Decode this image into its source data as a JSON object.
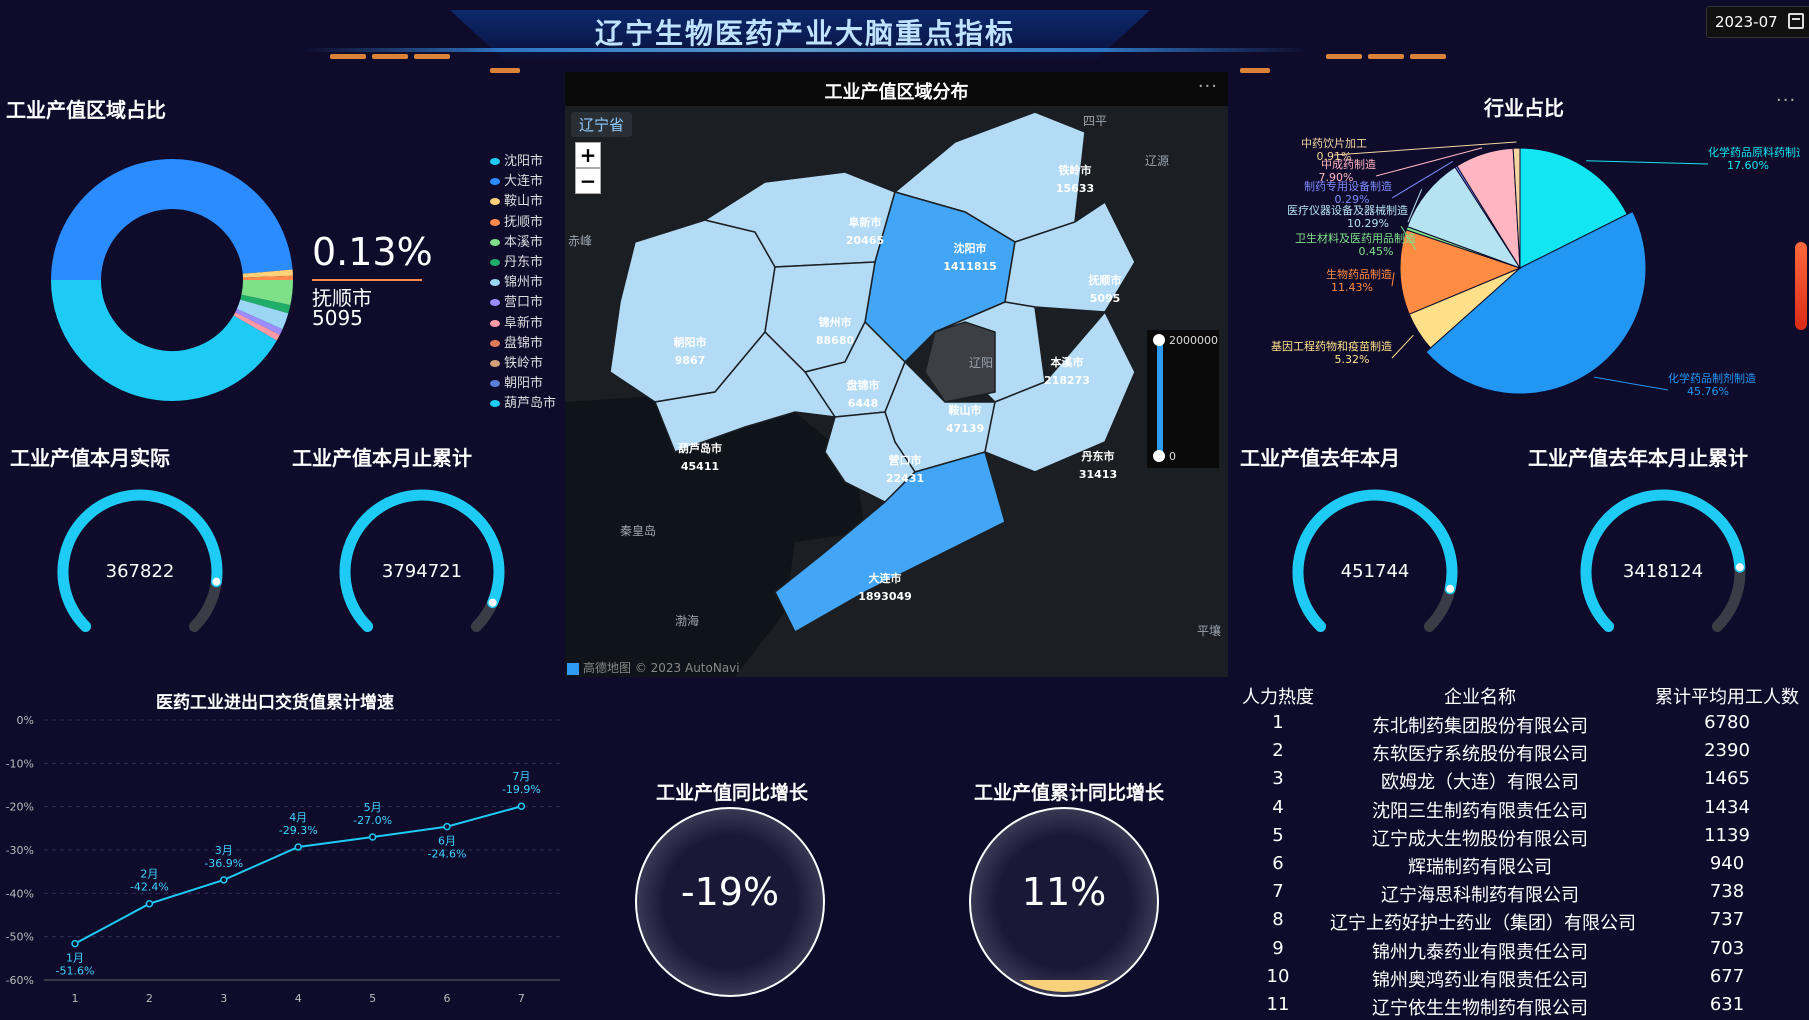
{
  "header": {
    "title": "辽宁生物医药产业大脑重点指标",
    "date": "2023-07"
  },
  "colors": {
    "background": "#0e0b2b",
    "accent_cyan": "#1ecbf5",
    "gauge_track": "#3a3d45",
    "map_dark": "#1b1f24"
  },
  "region_share": {
    "title": "工业产值区域占比",
    "highlight": {
      "percent": "0.13%",
      "city": "抚顺市",
      "value": "5095"
    },
    "legend": [
      {
        "name": "沈阳市",
        "color": "#1ecbf5"
      },
      {
        "name": "大连市",
        "color": "#2b8cff"
      },
      {
        "name": "鞍山市",
        "color": "#ffd27a"
      },
      {
        "name": "抚顺市",
        "color": "#ff8a4c"
      },
      {
        "name": "本溪市",
        "color": "#7fe08a"
      },
      {
        "name": "丹东市",
        "color": "#1fae6a"
      },
      {
        "name": "锦州市",
        "color": "#9bd6f5"
      },
      {
        "name": "营口市",
        "color": "#9b8cff"
      },
      {
        "name": "阜新市",
        "color": "#ff9aa6"
      },
      {
        "name": "盘锦市",
        "color": "#e0785a"
      },
      {
        "name": "铁岭市",
        "color": "#d4a27a"
      },
      {
        "name": "朝阳市",
        "color": "#5a7fd6"
      },
      {
        "name": "葫芦岛市",
        "color": "#1ecbf5"
      }
    ]
  },
  "gauges": [
    {
      "title": "工业产值本月实际",
      "value": "367822",
      "fraction": 0.86
    },
    {
      "title": "工业产值本月止累计",
      "value": "3794721",
      "fraction": 0.92
    },
    {
      "title": "工业产值去年本月",
      "value": "451744",
      "fraction": 0.88
    },
    {
      "title": "工业产值去年本月止累计",
      "value": "3418124",
      "fraction": 0.82
    }
  ],
  "map": {
    "title": "工业产值区域分布",
    "province": "辽宁省",
    "zoom_in": "+",
    "zoom_out": "−",
    "scale_max": "2000000",
    "scale_min": "0",
    "footer": "高德地图 © 2023 AutoNavi",
    "more": "···",
    "regions": [
      {
        "name": "铁岭市",
        "value": "15633"
      },
      {
        "name": "阜新市",
        "value": "20465"
      },
      {
        "name": "沈阳市",
        "value": "1411815"
      },
      {
        "name": "抚顺市",
        "value": "5095"
      },
      {
        "name": "朝阳市",
        "value": "9867"
      },
      {
        "name": "锦州市",
        "value": "88680"
      },
      {
        "name": "盘锦市",
        "value": "6448"
      },
      {
        "name": "本溪市",
        "value": "218273"
      },
      {
        "name": "鞍山市",
        "value": "47139"
      },
      {
        "name": "葫芦岛市",
        "value": "45411"
      },
      {
        "name": "营口市",
        "value": "22431"
      },
      {
        "name": "丹东市",
        "value": "31413"
      },
      {
        "name": "大连市",
        "value": "1893049"
      }
    ],
    "places": [
      "辽源",
      "赤峰",
      "秦皇岛",
      "渤海",
      "平壤",
      "辽阳",
      "四平"
    ]
  },
  "industry_share": {
    "title": "行业占比",
    "more": "···",
    "slices": [
      {
        "name": "化学药品原料药制造",
        "pct": "17.60%",
        "value": 17.6,
        "color": "#11e6f2"
      },
      {
        "name": "化学药品制剂制造",
        "pct": "45.76%",
        "value": 45.76,
        "color": "#2196f3"
      },
      {
        "name": "基因工程药物和疫苗制造",
        "pct": "5.32%",
        "value": 5.32,
        "color": "#ffe08a"
      },
      {
        "name": "生物药品制造",
        "pct": "11.43%",
        "value": 11.43,
        "color": "#ff8c42"
      },
      {
        "name": "卫生材料及医药用品制造",
        "pct": "0.45%",
        "value": 0.45,
        "color": "#7fe08a"
      },
      {
        "name": "医疗仪器设备及器械制造",
        "pct": "10.29%",
        "value": 10.29,
        "color": "#b5e3f2"
      },
      {
        "name": "制药专用设备制造",
        "pct": "0.29%",
        "value": 0.29,
        "color": "#7c8cff"
      },
      {
        "name": "中成药制造",
        "pct": "7.90%",
        "value": 7.9,
        "color": "#ffb6c1"
      },
      {
        "name": "中药饮片加工",
        "pct": "0.91%",
        "value": 0.91,
        "color": "#f5d6a0"
      }
    ]
  },
  "chart_data": {
    "type": "line",
    "title": "医药工业进出口交货值累计增速",
    "x": [
      1,
      2,
      3,
      4,
      5,
      6,
      7
    ],
    "series": [
      {
        "values": [
          -51.6,
          -42.4,
          -36.9,
          -29.3,
          -27.0,
          -24.6,
          -19.9
        ]
      }
    ],
    "point_labels": [
      "1月",
      "2月",
      "3月",
      "4月",
      "5月",
      "6月",
      "7月"
    ],
    "value_labels": [
      "-51.6%",
      "-42.4%",
      "-36.9%",
      "-29.3%",
      "-27.0%",
      "-24.6%",
      "-19.9%"
    ],
    "y_ticks": [
      "0%",
      "-10%",
      "-20%",
      "-30%",
      "-40%",
      "-50%",
      "-60%"
    ],
    "ylim": [
      -60,
      0
    ],
    "grid": true
  },
  "growth": [
    {
      "title": "工业产值同比增长",
      "value": "-19%"
    },
    {
      "title": "工业产值累计同比增长",
      "value": "11%"
    }
  ],
  "table": {
    "headers": [
      "人力热度",
      "企业名称",
      "累计平均用工人数"
    ],
    "rows": [
      [
        "1",
        "东北制药集团股份有限公司",
        "6780"
      ],
      [
        "2",
        "东软医疗系统股份有限公司",
        "2390"
      ],
      [
        "3",
        "欧姆龙（大连）有限公司",
        "1465"
      ],
      [
        "4",
        "沈阳三生制药有限责任公司",
        "1434"
      ],
      [
        "5",
        "辽宁成大生物股份有限公司",
        "1139"
      ],
      [
        "6",
        "辉瑞制药有限公司",
        "940"
      ],
      [
        "7",
        "辽宁海思科制药有限公司",
        "738"
      ],
      [
        "8",
        "辽宁上药好护士药业（集团）有限公司",
        "737"
      ],
      [
        "9",
        "锦州九泰药业有限责任公司",
        "703"
      ],
      [
        "10",
        "锦州奥鸿药业有限责任公司",
        "677"
      ],
      [
        "11",
        "辽宁依生生物制药有限公司",
        "631"
      ]
    ]
  }
}
